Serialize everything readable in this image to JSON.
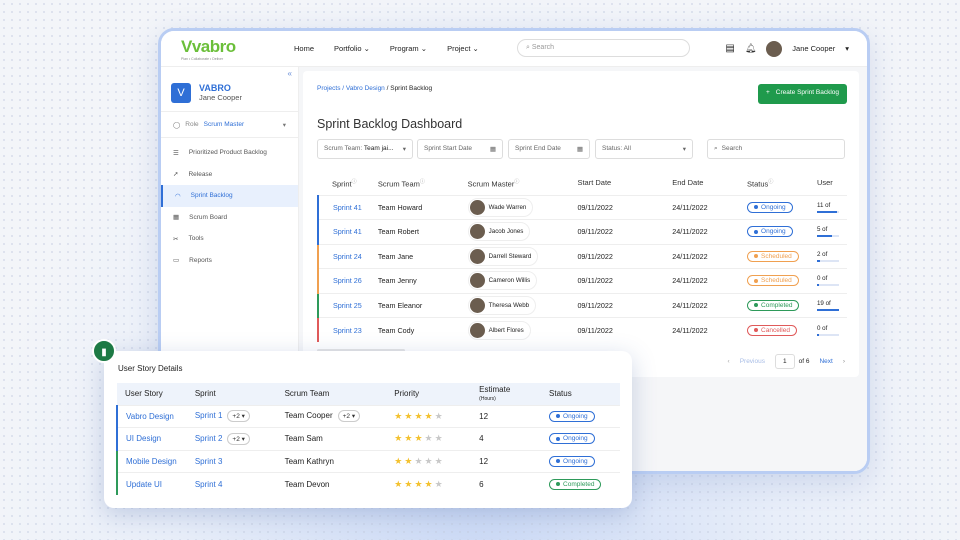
{
  "topbar": {
    "logo": "vabro",
    "tagline": "Plan • Collaborate • Deliver",
    "nav": [
      "Home",
      "Portfolio",
      "Program",
      "Project"
    ],
    "search_placeholder": "Search",
    "user": "Jane Cooper"
  },
  "sidebar": {
    "org_initial": "V",
    "org": "VABRO",
    "user": "Jane Cooper",
    "role_label": "Role",
    "role": "Scrum Master",
    "items": [
      "Prioritized Product Backlog",
      "Release",
      "Sprint Backlog",
      "Scrum Board",
      "Tools",
      "Reports"
    ]
  },
  "main": {
    "breadcrumb_links": "Projects / Vabro Design",
    "breadcrumb_current": " / Sprint Backlog",
    "create_button": "Create Sprint Backlog",
    "title": "Sprint Backlog Dashboard",
    "filters": {
      "team_label": "Scrum Team:",
      "team_value": "Team jai...",
      "start": "Sprint Start Date",
      "end": "Sprint End Date",
      "status": "Status: All",
      "search_placeholder": "Search"
    },
    "columns": [
      "Sprint",
      "Scrum Team",
      "Scrum Master",
      "Start Date",
      "End Date",
      "Status",
      "User"
    ],
    "rows": [
      {
        "sprint": "Sprint 41",
        "team": "Team Howard",
        "master": "Wade Warren",
        "start": "09/11/2022",
        "end": "24/11/2022",
        "status": "Ongoing",
        "users": "11 of",
        "progress": 0.9,
        "color": "#2f6fd6"
      },
      {
        "sprint": "Sprint 41",
        "team": "Team Robert",
        "master": "Jacob Jones",
        "start": "09/11/2022",
        "end": "24/11/2022",
        "status": "Ongoing",
        "users": "5 of",
        "progress": 0.7,
        "color": "#2f6fd6"
      },
      {
        "sprint": "Sprint 24",
        "team": "Team Jane",
        "master": "Darrell Steward",
        "start": "09/11/2022",
        "end": "24/11/2022",
        "status": "Scheduled",
        "users": "2 of",
        "progress": 0.15,
        "color": "#f0a050"
      },
      {
        "sprint": "Sprint 26",
        "team": "Team Jenny",
        "master": "Cameron Willis",
        "start": "09/11/2022",
        "end": "24/11/2022",
        "status": "Scheduled",
        "users": "0 of",
        "progress": 0.1,
        "color": "#f0a050"
      },
      {
        "sprint": "Sprint 25",
        "team": "Team Eleanor",
        "master": "Theresa Webb",
        "start": "09/11/2022",
        "end": "24/11/2022",
        "status": "Completed",
        "users": "19 of",
        "progress": 1.0,
        "color": "#2e9a5a"
      },
      {
        "sprint": "Sprint 23",
        "team": "Team Cody",
        "master": "Albert Flores",
        "start": "09/11/2022",
        "end": "24/11/2022",
        "status": "Cancelled",
        "users": "0 of",
        "progress": 0.1,
        "color": "#e05a5a"
      }
    ],
    "pagination": {
      "previous": "Previous",
      "page": "1",
      "of": "of 6",
      "next": "Next"
    }
  },
  "story": {
    "title": "User Story Details",
    "columns": [
      "User Story",
      "Sprint",
      "Scrum Team",
      "Priority",
      "Estimate",
      "(Hours)",
      "Status"
    ],
    "rows": [
      {
        "story": "Vabro Design",
        "sprint": "Sprint 1",
        "sprint_more": "+2",
        "team": "Team Cooper",
        "team_more": "+2",
        "priority": 4,
        "estimate": "12",
        "status": "Ongoing"
      },
      {
        "story": "UI Design",
        "sprint": "Sprint 2",
        "sprint_more": "+2",
        "team": "Team Sam",
        "team_more": null,
        "priority": 3,
        "estimate": "4",
        "status": "Ongoing"
      },
      {
        "story": "Mobile Design",
        "sprint": "Sprint 3",
        "sprint_more": null,
        "team": "Team Kathryn",
        "team_more": null,
        "priority": 2,
        "estimate": "12",
        "status": "Ongoing"
      },
      {
        "story": "Update UI",
        "sprint": "Sprint 4",
        "sprint_more": null,
        "team": "Team Devon",
        "team_more": null,
        "priority": 4,
        "estimate": "6",
        "status": "Completed"
      }
    ]
  },
  "status_colors": {
    "Ongoing": "#2f6fd6",
    "Scheduled": "#f0a050",
    "Completed": "#2e9a5a",
    "Cancelled": "#e05a5a"
  }
}
